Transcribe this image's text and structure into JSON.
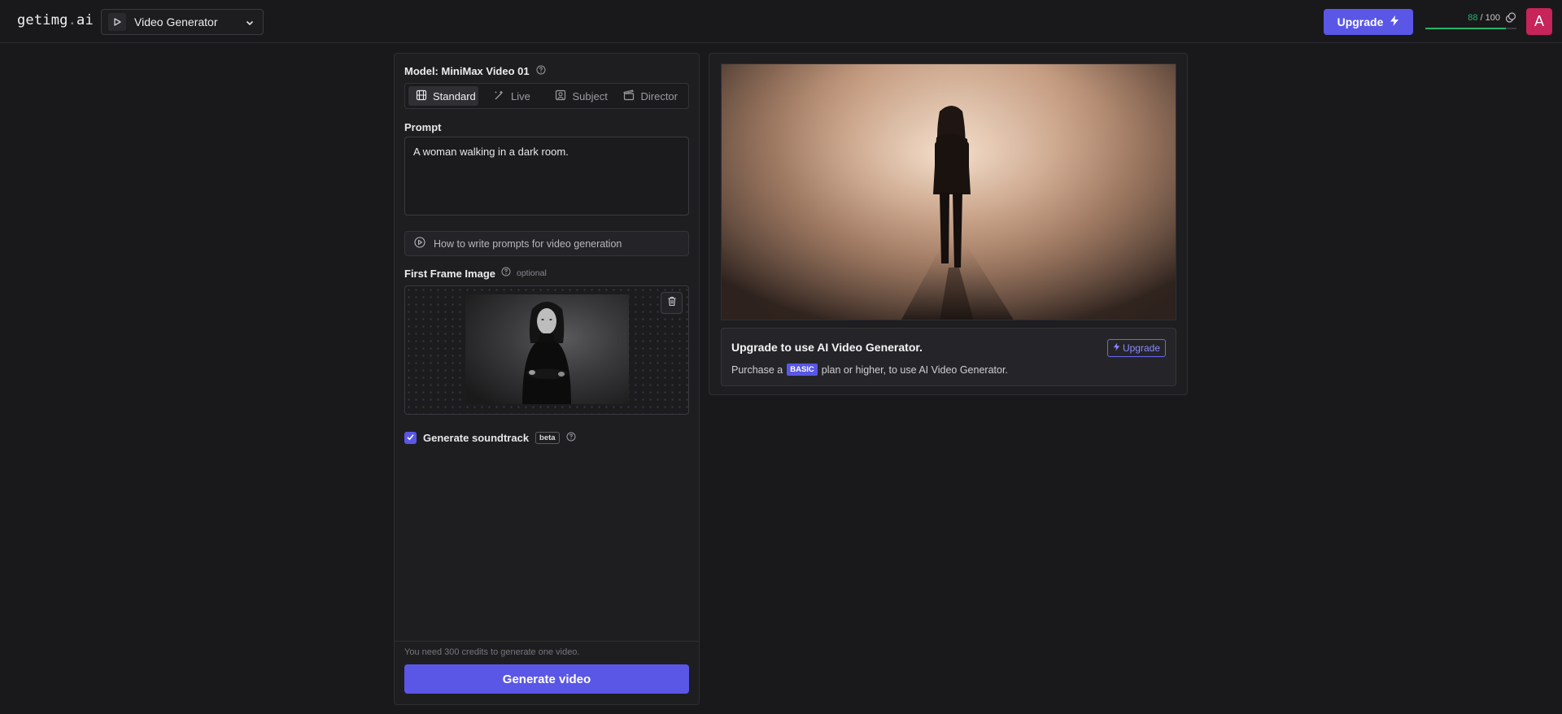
{
  "header": {
    "logo_main": "getimg",
    "logo_dot": ".",
    "logo_tld": "ai",
    "tool_select": {
      "label": "Video Generator",
      "icon": "play-icon"
    },
    "upgrade_label": "Upgrade",
    "credits": {
      "current": "88",
      "total": "/ 100",
      "fraction": 0.88
    },
    "avatar_letter": "A"
  },
  "form": {
    "model_label": "Model: MiniMax Video 01",
    "modes": [
      {
        "label": "Standard",
        "icon": "film-icon",
        "active": true
      },
      {
        "label": "Live",
        "icon": "wand-icon",
        "active": false
      },
      {
        "label": "Subject",
        "icon": "portrait-icon",
        "active": false
      },
      {
        "label": "Director",
        "icon": "clapper-icon",
        "active": false
      }
    ],
    "prompt_label": "Prompt",
    "prompt_value": "A woman walking in a dark room.",
    "howto_label": "How to write prompts for video generation",
    "first_frame_label": "First Frame Image",
    "first_frame_optional": "optional",
    "soundtrack_label": "Generate soundtrack",
    "soundtrack_checked": true,
    "beta_badge": "beta",
    "credits_note": "You need 300 credits to generate one video.",
    "generate_label": "Generate video"
  },
  "preview": {
    "card_title": "Upgrade to use AI Video Generator.",
    "upgrade_button": "Upgrade",
    "desc_prefix": "Purchase a",
    "plan_badge": "BASIC",
    "desc_suffix": "plan or higher, to use AI Video Generator."
  },
  "colors": {
    "accent": "#5a57e6",
    "credits_green": "#25b36a",
    "avatar": "#c7245a"
  }
}
